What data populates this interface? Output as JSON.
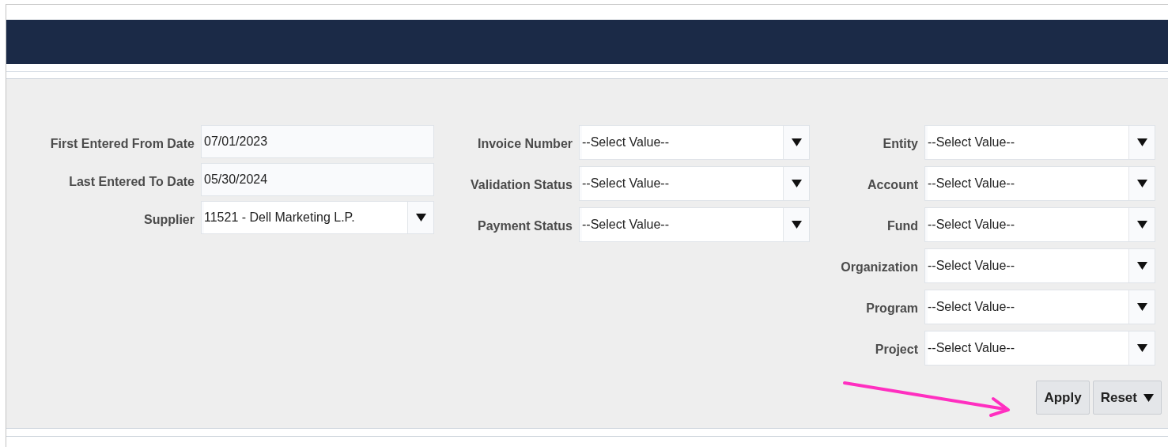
{
  "filters": {
    "columns": [
      [
        {
          "label": "First Entered From Date",
          "kind": "text",
          "value": "07/01/2023"
        },
        {
          "label": "Last Entered To Date",
          "kind": "text",
          "value": "05/30/2024"
        },
        {
          "label": "Supplier",
          "kind": "select",
          "value": "11521 - Dell Marketing L.P."
        }
      ],
      [
        {
          "label": "Invoice Number",
          "kind": "select",
          "value": "--Select Value--"
        },
        {
          "label": "Validation Status",
          "kind": "select",
          "value": "--Select Value--"
        },
        {
          "label": "Payment Status",
          "kind": "select",
          "value": "--Select Value--"
        }
      ],
      [
        {
          "label": "Entity",
          "kind": "select",
          "value": "--Select Value--"
        },
        {
          "label": "Account",
          "kind": "select",
          "value": "--Select Value--"
        },
        {
          "label": "Fund",
          "kind": "select",
          "value": "--Select Value--"
        },
        {
          "label": "Organization",
          "kind": "select",
          "value": "--Select Value--"
        },
        {
          "label": "Program",
          "kind": "select",
          "value": "--Select Value--"
        },
        {
          "label": "Project",
          "kind": "select",
          "value": "--Select Value--"
        }
      ]
    ]
  },
  "buttons": [
    {
      "label": "Apply",
      "kind": "plain"
    },
    {
      "label": "Reset",
      "kind": "menu"
    }
  ]
}
